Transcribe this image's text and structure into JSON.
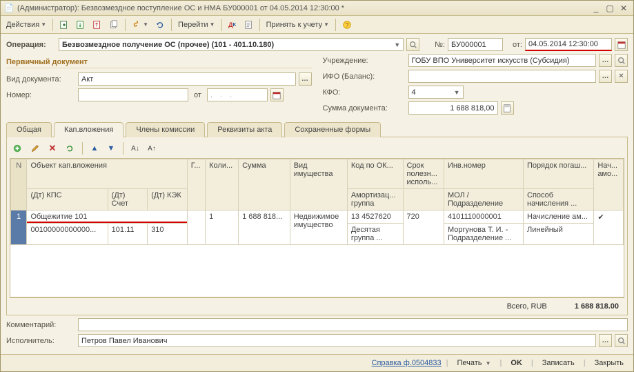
{
  "title": "(Администратор): Безвозмездное поступление ОС и НМА БУ000001 от 04.05.2014 12:30:00 *",
  "toolbar": {
    "actions": "Действия",
    "goto": "Перейти",
    "accept": "Принять к учету"
  },
  "header": {
    "operation_lbl": "Операция:",
    "operation_val": "Безвозмездное получение ОС (прочее) (101 - 401.10.180)",
    "num_lbl": "№:",
    "num_val": "БУ000001",
    "from_lbl": "от:",
    "date_val": "04.05.2014 12:30:00"
  },
  "left": {
    "section": "Первичный документ",
    "doc_type_lbl": "Вид документа:",
    "doc_type_val": "Акт",
    "number_lbl": "Номер:",
    "number_val": "",
    "from_lbl": "от",
    "date_val": ". . ."
  },
  "right": {
    "inst_lbl": "Учреждение:",
    "inst_val": "ГОБУ ВПО Университет искусств (Субсидия)",
    "ifo_lbl": "ИФО (Баланс):",
    "ifo_val": "",
    "kfo_lbl": "КФО:",
    "kfo_val": "4",
    "sum_lbl": "Сумма документа:",
    "sum_val": "1 688 818,00"
  },
  "tabs": [
    "Общая",
    "Кап.вложения",
    "Члены комиссии",
    "Реквизиты акта",
    "Сохраненные формы"
  ],
  "grid": {
    "h": {
      "n": "N",
      "obj": "Объект кап.вложения",
      "dt_kps": "(Дт) КПС",
      "dt_schet": "(Дт) Счет",
      "dt_kek": "(Дт) КЭК",
      "g": "Г...",
      "qty": "Коли...",
      "sum": "Сумма",
      "prop": "Вид имущества",
      "okof": "Код по ОК...",
      "amort_group": "Амортизац... группа",
      "life": "Срок полезн... исполь...",
      "inv": "Инв.номер",
      "mol": "МОЛ / Подразделение",
      "order": "Порядок погаш...",
      "method": "Способ начисления ...",
      "nach": "Нач... амо..."
    },
    "rows": [
      {
        "n": "1",
        "obj": "Общежитие 101",
        "dt_kps": "00100000000000...",
        "dt_schet": "101.11",
        "dt_kek": "310",
        "g": "",
        "qty": "1",
        "sum": "1 688 818...",
        "prop": "Недвижимое имущество",
        "okof": "13 4527620",
        "amort_group": "Десятая группа ...",
        "life": "720",
        "inv": "4101110000001",
        "mol": "Моргунова Т. И. - Подразделение ...",
        "order": "Начисление ам...",
        "method": "Линейный",
        "nach": "✔"
      }
    ]
  },
  "totals": {
    "lbl": "Всего, RUB",
    "val": "1 688 818.00"
  },
  "footer": {
    "comment_lbl": "Комментарий:",
    "comment_val": "",
    "executor_lbl": "Исполнитель:",
    "executor_val": "Петров Павел Иванович"
  },
  "bottom": {
    "ref": "Справка ф.0504833",
    "print": "Печать",
    "ok": "OK",
    "save": "Записать",
    "close": "Закрыть"
  }
}
